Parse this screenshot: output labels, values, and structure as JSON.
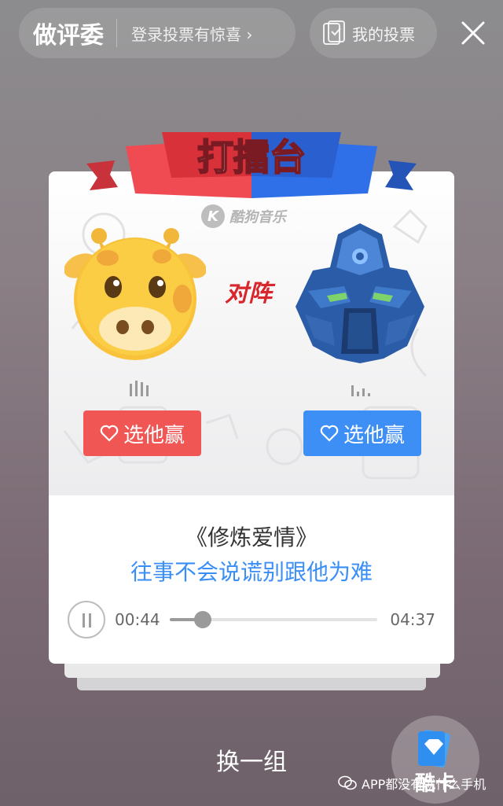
{
  "header": {
    "title": "做评委",
    "promo": "登录投票有惊喜 ›",
    "my_votes": "我的投票",
    "close_icon": "close-icon"
  },
  "banner": {
    "text": "打擂台",
    "colors": {
      "left": "#f04a52",
      "right": "#2f6fe8"
    }
  },
  "card": {
    "brand": {
      "logo_letter": "K",
      "name": "酷狗音乐"
    },
    "versus": "对阵",
    "left_contestant": {
      "avatar": "giraffe-avatar",
      "vote_label": "选他赢",
      "color": "#f05654"
    },
    "right_contestant": {
      "avatar": "robot-avatar",
      "vote_label": "选他赢",
      "color": "#3d8ef5"
    },
    "song_title": "《修炼爱情》",
    "lyric": "往事不会说谎别跟他为难",
    "player": {
      "current_time": "00:44",
      "total_time": "04:37",
      "progress": 0.16
    }
  },
  "footer": {
    "switch_label": "换一组",
    "cool_card_label": "酷卡",
    "watermark": "APP都没有就什么手机"
  }
}
